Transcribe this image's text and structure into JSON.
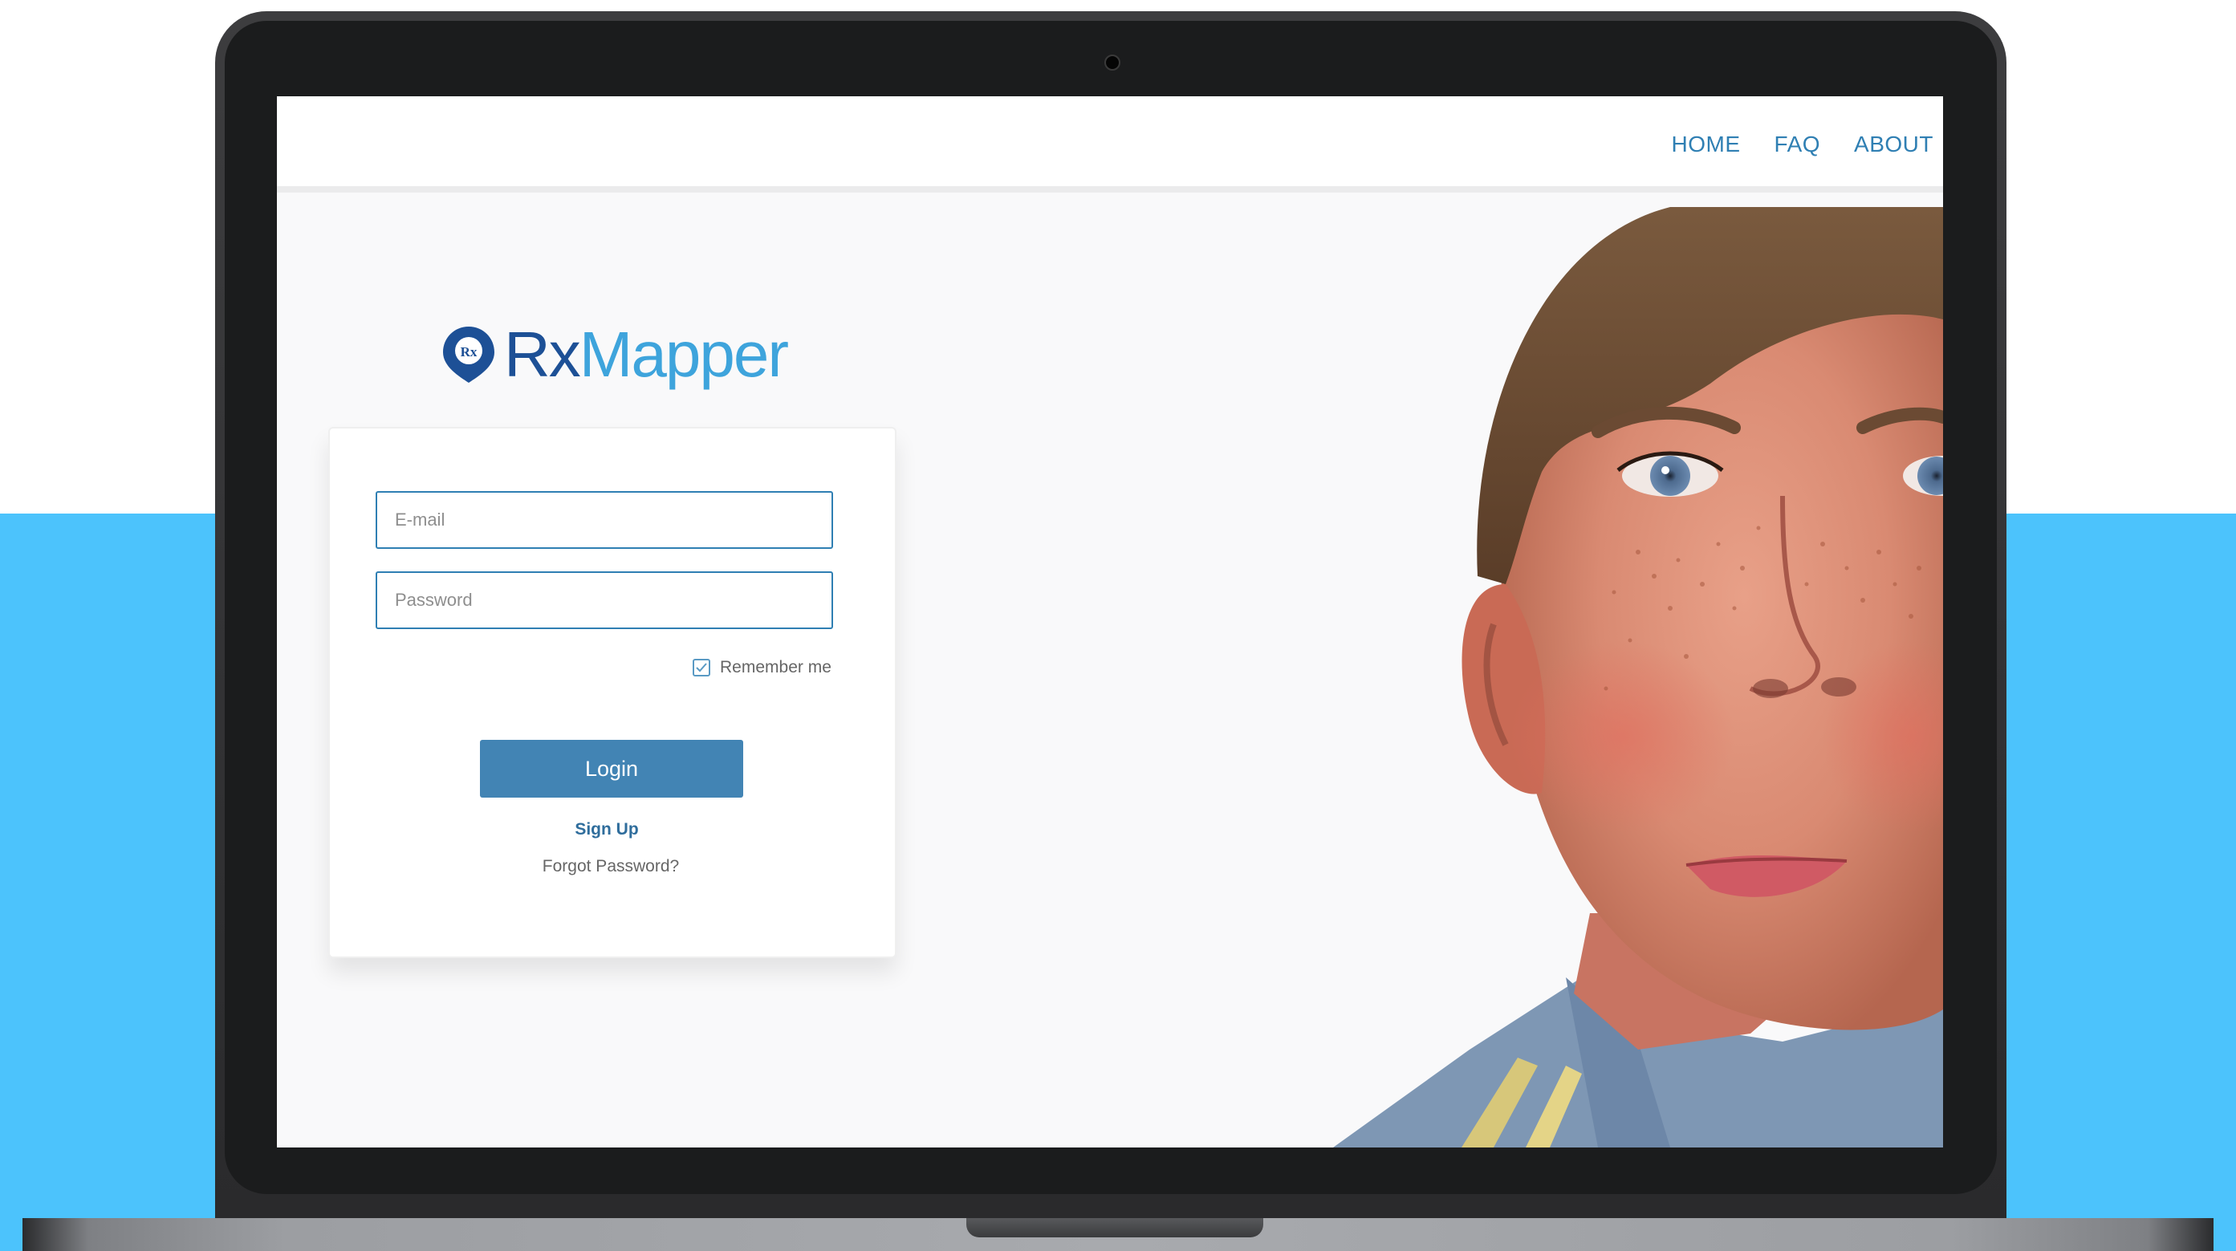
{
  "brand": {
    "name_part1": "Rx",
    "name_part2": "Mapper",
    "icon": "map-pin-rx-icon",
    "icon_text": "Rx",
    "color_dark": "#1d5096",
    "color_light": "#3ea4dc"
  },
  "nav": {
    "items": [
      {
        "label": "HOME"
      },
      {
        "label": "FAQ"
      },
      {
        "label": "ABOUT"
      }
    ],
    "color": "#2f7fb3"
  },
  "login_form": {
    "email_placeholder": "E-mail",
    "email_value": "",
    "password_placeholder": "Password",
    "password_value": "",
    "remember_label": "Remember me",
    "remember_checked": true,
    "login_label": "Login",
    "signup_label": "Sign Up",
    "forgot_label": "Forgot Password?",
    "button_color": "#4284b4"
  },
  "hero_image": {
    "subject": "close-up portrait of a freckled boy"
  },
  "background_color": "#4cc3fc"
}
